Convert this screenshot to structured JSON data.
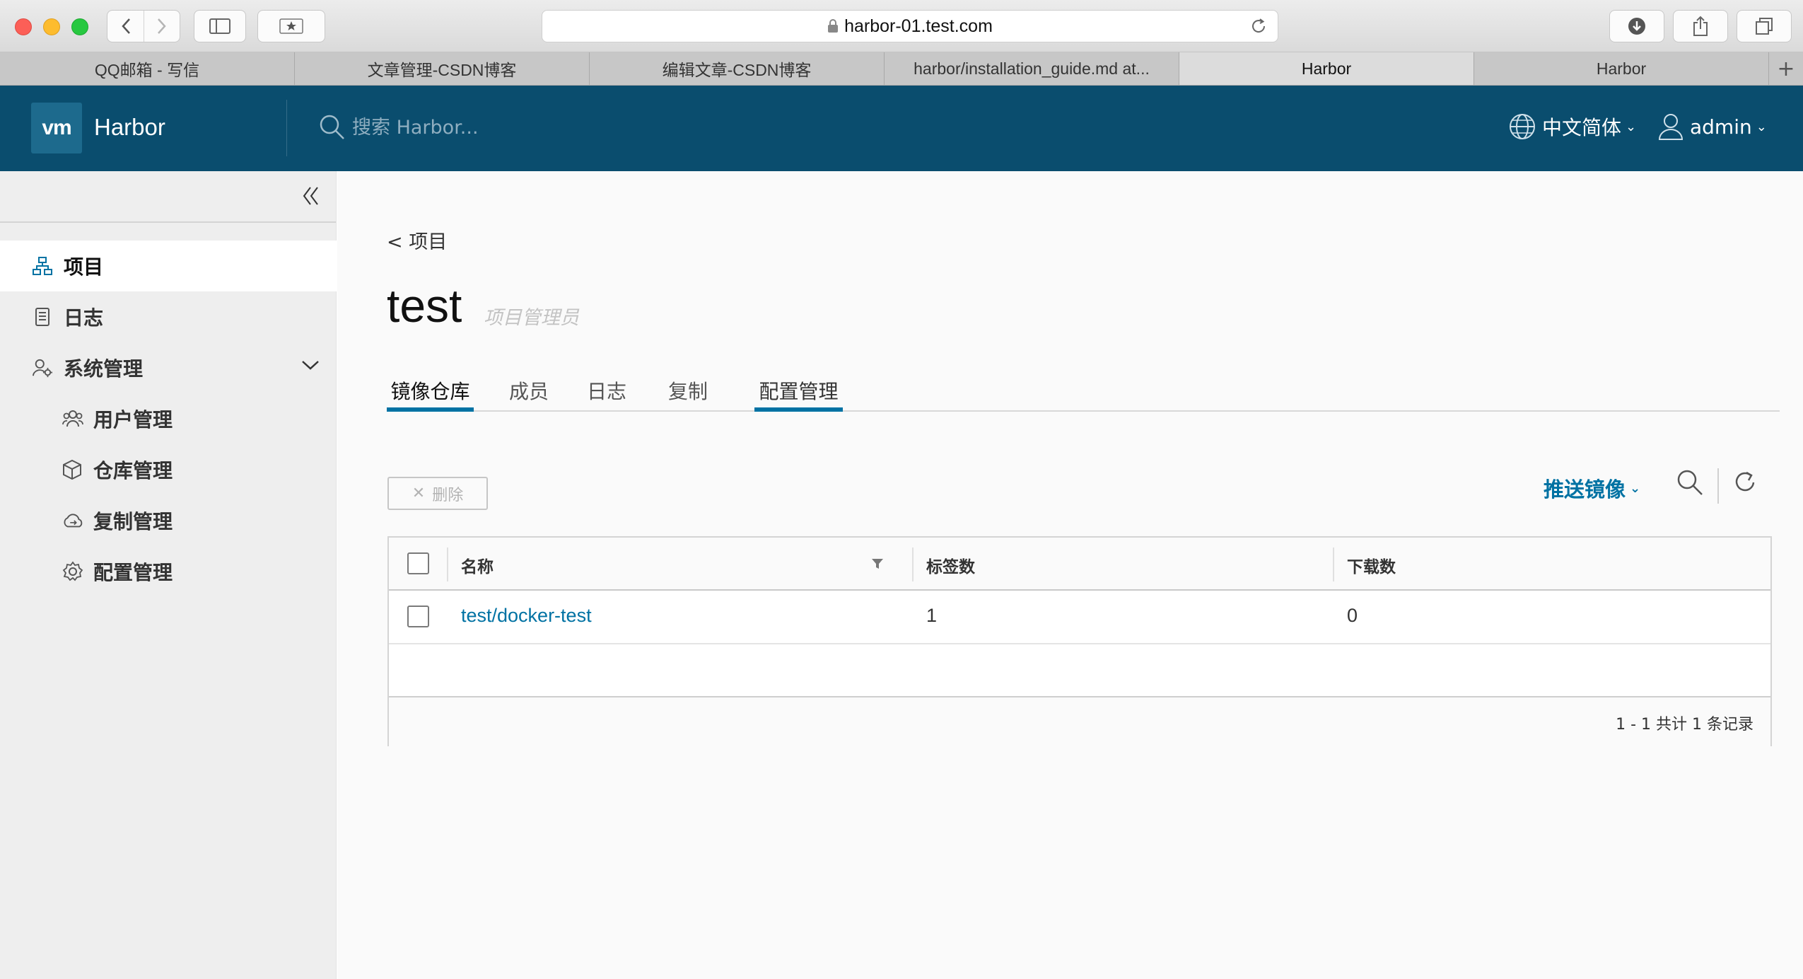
{
  "browser": {
    "url": "harbor-01.test.com",
    "tabs": [
      {
        "label": "QQ邮箱 - 写信",
        "active": false
      },
      {
        "label": "文章管理-CSDN博客",
        "active": false
      },
      {
        "label": "编辑文章-CSDN博客",
        "active": false
      },
      {
        "label": "harbor/installation_guide.md at...",
        "active": false
      },
      {
        "label": "Harbor",
        "active": true
      },
      {
        "label": "Harbor",
        "active": false
      }
    ],
    "new_tab_label": "+"
  },
  "header": {
    "logo_text": "vm",
    "brand": "Harbor",
    "search_placeholder": "搜索 Harbor...",
    "language": "中文简体",
    "user": "admin"
  },
  "sidebar": {
    "items": [
      {
        "label": "项目",
        "icon": "projects-icon",
        "active": true
      },
      {
        "label": "日志",
        "icon": "logs-icon",
        "active": false
      },
      {
        "label": "系统管理",
        "icon": "admin-icon",
        "active": false,
        "expanded": true
      }
    ],
    "sub_items": [
      {
        "label": "用户管理",
        "icon": "users-icon"
      },
      {
        "label": "仓库管理",
        "icon": "registry-icon"
      },
      {
        "label": "复制管理",
        "icon": "replication-icon"
      },
      {
        "label": "配置管理",
        "icon": "config-icon"
      }
    ]
  },
  "main": {
    "breadcrumb": "< 项目",
    "title": "test",
    "role": "项目管理员",
    "tabs": [
      {
        "label": "镜像仓库",
        "active": true
      },
      {
        "label": "成员",
        "active": false
      },
      {
        "label": "日志",
        "active": false
      },
      {
        "label": "复制",
        "active": false
      },
      {
        "label": "配置管理",
        "active": false
      }
    ],
    "delete_label": "删除",
    "push_label": "推送镜像",
    "columns": [
      "名称",
      "标签数",
      "下载数"
    ],
    "rows": [
      {
        "name": "test/docker-test",
        "tags": "1",
        "pulls": "0"
      }
    ],
    "pagination": "1 - 1 共计 1 条记录"
  },
  "colors": {
    "header_bg": "#0a4d6e",
    "accent": "#0072a3",
    "sidebar_bg": "#eeeeee"
  }
}
